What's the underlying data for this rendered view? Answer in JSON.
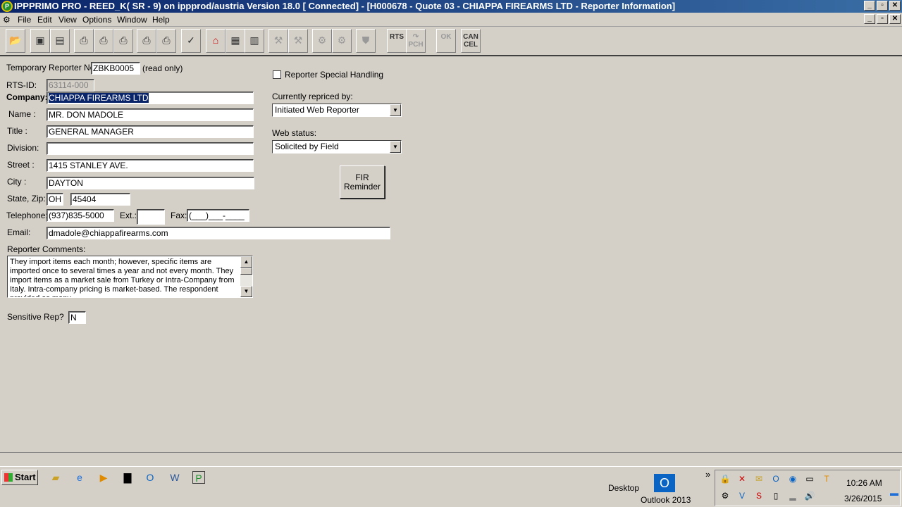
{
  "window": {
    "title": "IPPPRIMO PRO - REED_K( SR - 9) on ippprod/austria Version 18.0 [ Connected]  - [H000678  - Quote 03 - CHIAPPA FIREARMS LTD - Reporter Information]",
    "min": "_",
    "max": "▫",
    "close": "✕"
  },
  "menu": {
    "file": "File",
    "edit": "Edit",
    "view": "View",
    "options": "Options",
    "window": "Window",
    "help": "Help"
  },
  "toolbar": {
    "rts": "RTS",
    "pch": "PCH",
    "ok": "OK",
    "cancel_line1": "CAN",
    "cancel_line2": "CEL"
  },
  "form": {
    "temp_reporter_label": "Temporary Reporter No.:",
    "temp_reporter_value": "ZBKB0005",
    "read_only": "(read only)",
    "rts_id_label": "RTS-ID:",
    "rts_id_value": "63114-000",
    "company_label": "Company:",
    "company_value": "CHIAPPA FIREARMS LTD",
    "name_label": "Name :",
    "name_value": "MR. DON MADOLE",
    "title_label": "Title :",
    "title_value": "GENERAL MANAGER",
    "division_label": "Division:",
    "division_value": "",
    "street_label": "Street :",
    "street_value": "1415 STANLEY AVE.",
    "city_label": "City :",
    "city_value": "DAYTON",
    "state_zip_label": "State, Zip:",
    "state_value": "OH",
    "zip_value": "45404",
    "telephone_label": "Telephone:",
    "telephone_value": "(937)835-5000",
    "ext_label": "Ext.:",
    "ext_value": "",
    "fax_label": "Fax:",
    "fax_value": "(___)___-____",
    "email_label": "Email:",
    "email_value": "dmadole@chiappafirearms.com",
    "comments_label": "Reporter Comments:",
    "comments_value": " They import items each month; however, specific items are imported once to several times a year and not every month. They import items as a market sale from Turkey or Intra-Company from Italy. Intra-company pricing is market-based. The respondent provided as many",
    "sensitive_label": "Sensitive Rep?",
    "sensitive_value": "N",
    "special_handling_label": "Reporter Special Handling",
    "repriced_label": "Currently repriced by:",
    "repriced_value": "Initiated Web Reporter",
    "web_status_label": "Web status:",
    "web_status_value": "Solicited by Field",
    "fir_line1": "FIR",
    "fir_line2": "Reminder"
  },
  "taskbar": {
    "start": "Start",
    "desktop": "Desktop",
    "outlook": "Outlook 2013",
    "time": "10:26 AM",
    "date": "3/26/2015",
    "chevron": "»"
  }
}
